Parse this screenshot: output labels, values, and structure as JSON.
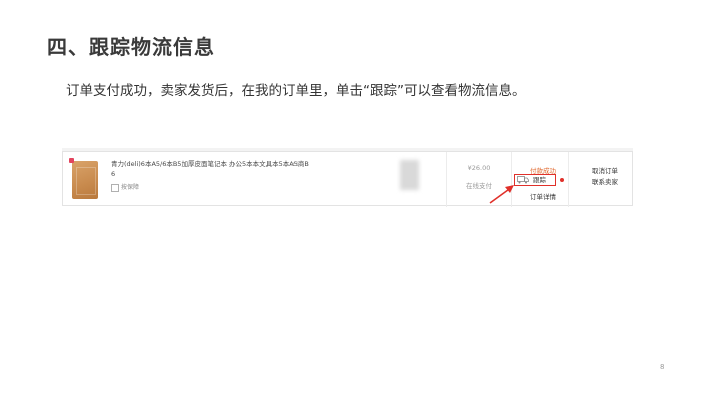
{
  "slide": {
    "title": "四、跟踪物流信息",
    "description": "订单支付成功，卖家发货后，在我的订单里，单击“跟踪”可以查看物流信息。",
    "page_number": "8"
  },
  "order": {
    "product_name": "青力(deli)6本A5/6本B5加厚皮面笔记本 办公5本本文具本5本A5商B 6",
    "protection": "按保障",
    "quantity": "x1",
    "price": "¥26.00",
    "payment_type": "在线支付",
    "status": "付款成功",
    "track_label": "跟踪",
    "detail_label": "订单详情",
    "cancel_label": "取消订单",
    "contact_label": "联系卖家"
  },
  "colors": {
    "highlight": "#e0302a",
    "status": "#e0672c"
  },
  "icons": {
    "track": "truck-icon",
    "protection": "shield-icon"
  }
}
